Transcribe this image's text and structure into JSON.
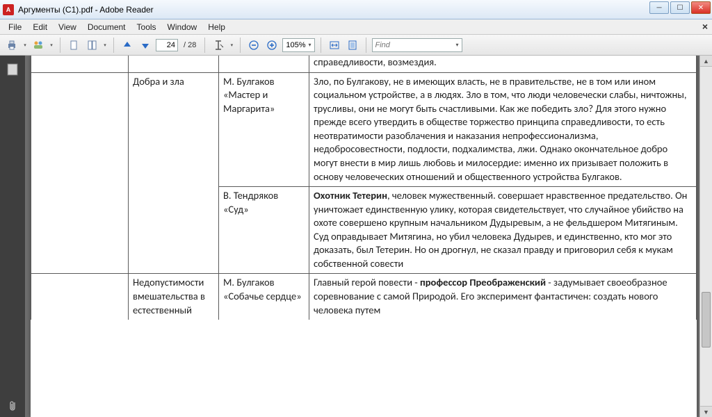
{
  "window": {
    "title": "Аргументы (С1).pdf - Adobe Reader",
    "app_icon_text": "A"
  },
  "menu": {
    "file": "File",
    "edit": "Edit",
    "view": "View",
    "document": "Document",
    "tools": "Tools",
    "window": "Window",
    "help": "Help",
    "close_x": "×"
  },
  "toolbar": {
    "page_current": "24",
    "page_total": "/ 28",
    "zoom": "105%",
    "find_placeholder": "Find"
  },
  "doc": {
    "trunc_top": "справедливости, возмездия.",
    "r1": {
      "c1": "Добра и зла",
      "c2": "М. Булгаков «Мастер и Маргарита»",
      "c3": "Зло, по Булгакову, не в имеющих власть, не в правительстве, не в том или ином социальном устройстве, а в людях. Зло в том, что люди человечески слабы, ничтожны, трусливы, они не могут быть счастливыми. Как же победить зло? Для этого нужно прежде всего утвердить в обществе торжество принципа справедливости, то есть неотвратимости разоблачения и наказания непрофессионализма, недобросовестности, подлости, подхалимства, лжи. Однако окончательное добро могут внести в мир лишь любовь и милосердие: именно их призывает положить в основу человеческих отношений и общественного устройства Булгаков."
    },
    "r2": {
      "c2": "В. Тендряков «Суд»",
      "c3_bold": "Охотник Тетерин",
      "c3_rest": ", человек мужественный. совершает нравственное предательство. Он уничтожает единственную улику, которая свидетельствует, что случайное убийство на охоте совершено крупным начальником Дудыревым, а не фельдшером Митягиным. Суд оправдывает Митягина, но убил человека Дудырев, и единственно, кто мог это доказать, был Тетерин. Но он дрогнул, не сказал правду и приговорил себя к мукам собственной совести"
    },
    "r3": {
      "c1": "Недопустимости вмешательства в естественный",
      "c2": "М. Булгаков «Собачье сердце»",
      "c3_a": "Главный герой повести - ",
      "c3_bold": "профессор Преображенский",
      "c3_b": " - задумывает своеобразное соревнование с самой Природой. Его эксперимент фантастичен: создать нового человека путем"
    }
  }
}
